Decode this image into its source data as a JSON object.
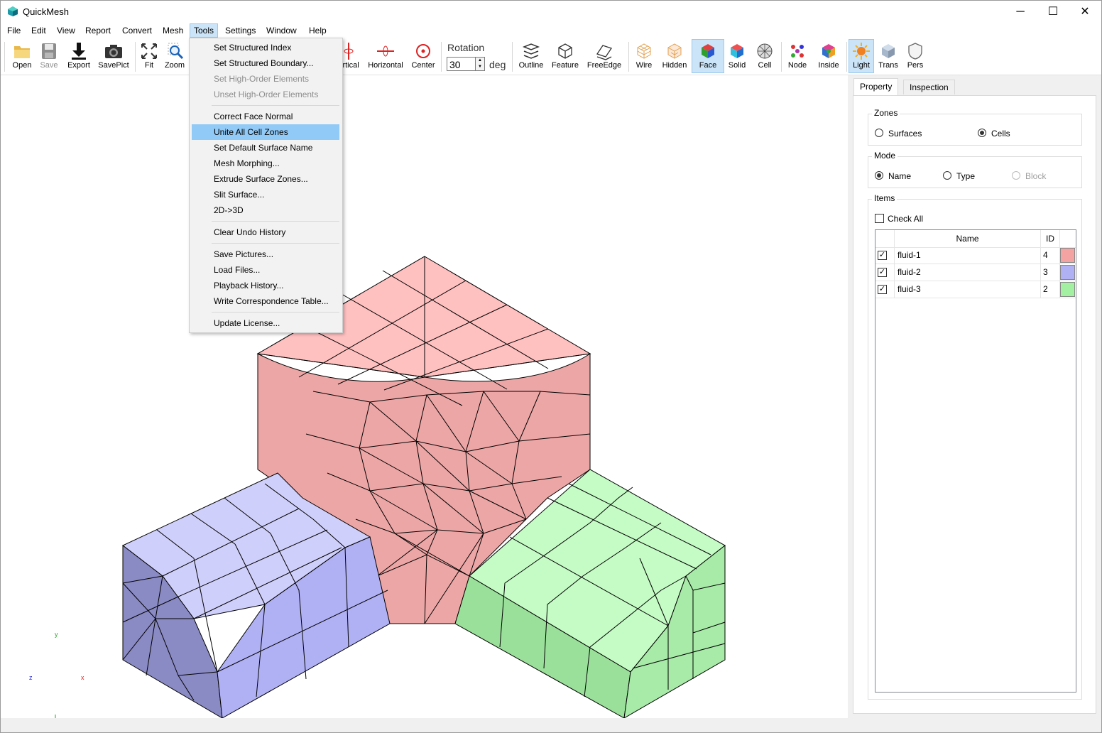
{
  "window": {
    "title": "QuickMesh",
    "minimize": "─",
    "maximize": "☐",
    "close": "✕"
  },
  "menubar": [
    "File",
    "Edit",
    "View",
    "Report",
    "Convert",
    "Mesh",
    "Tools",
    "Settings",
    "Window",
    "Help"
  ],
  "toolbar": {
    "open": "Open",
    "save": "Save",
    "export": "Export",
    "savepict": "SavePict",
    "fit": "Fit",
    "zoom": "Zoom",
    "vertical": "ertical",
    "horizontal": "Horizontal",
    "center": "Center",
    "rotation_label": "Rotation",
    "rotation_value": "30",
    "rotation_unit": "deg",
    "outline": "Outline",
    "feature": "Feature",
    "freeedge": "FreeEdge",
    "wire": "Wire",
    "hidden": "Hidden",
    "face": "Face",
    "solid": "Solid",
    "cell": "Cell",
    "node": "Node",
    "inside": "Inside",
    "light": "Light",
    "trans": "Trans",
    "pers": "Pers"
  },
  "tools_menu": {
    "items": [
      {
        "label": "Set Structured Index",
        "disabled": false
      },
      {
        "label": "Set Structured Boundary...",
        "disabled": false
      },
      {
        "label": "Set High-Order Elements",
        "disabled": true
      },
      {
        "label": "Unset High-Order Elements",
        "disabled": true
      },
      {
        "label": "Correct Face Normal",
        "disabled": false
      },
      {
        "label": "Unite All Cell Zones",
        "disabled": false,
        "highlighted": true
      },
      {
        "label": "Set Default Surface Name",
        "disabled": false
      },
      {
        "label": "Mesh Morphing...",
        "disabled": false
      },
      {
        "label": "Extrude Surface Zones...",
        "disabled": false
      },
      {
        "label": "Slit Surface...",
        "disabled": false
      },
      {
        "label": "2D->3D",
        "disabled": false
      },
      {
        "label": "Clear Undo History",
        "disabled": false
      },
      {
        "label": "Save Pictures...",
        "disabled": false
      },
      {
        "label": "Load Files...",
        "disabled": false
      },
      {
        "label": "Playback History...",
        "disabled": false
      },
      {
        "label": "Write Correspondence Table...",
        "disabled": false
      },
      {
        "label": "Update License...",
        "disabled": false
      }
    ]
  },
  "panel": {
    "tabs": [
      "Property",
      "Inspection"
    ],
    "zones": {
      "title": "Zones",
      "options": [
        "Surfaces",
        "Cells"
      ],
      "selected": "Cells"
    },
    "mode": {
      "title": "Mode",
      "options": [
        "Name",
        "Type",
        "Block"
      ],
      "selected": "Name",
      "disabled": [
        "Block"
      ]
    },
    "items": {
      "title": "Items",
      "check_all": "Check All",
      "columns": [
        "Name",
        "ID"
      ],
      "rows": [
        {
          "name": "fluid-1",
          "id": "4",
          "checked": true,
          "color": "#f4a3a3"
        },
        {
          "name": "fluid-2",
          "id": "3",
          "checked": true,
          "color": "#b0b0f4"
        },
        {
          "name": "fluid-3",
          "id": "2",
          "checked": true,
          "color": "#a3f0a3"
        }
      ]
    }
  },
  "axes": {
    "x": "x",
    "y": "y",
    "z": "z"
  },
  "colors": {
    "zone1_top": "#ffc0c0",
    "zone1_side": "#eca5a5",
    "zone2_top": "#cfcffb",
    "zone2_side": "#8a8ac4",
    "zone3_top": "#c5fbc5",
    "zone3_side": "#9adf9a",
    "menu_highlight": "#91c9f7"
  }
}
